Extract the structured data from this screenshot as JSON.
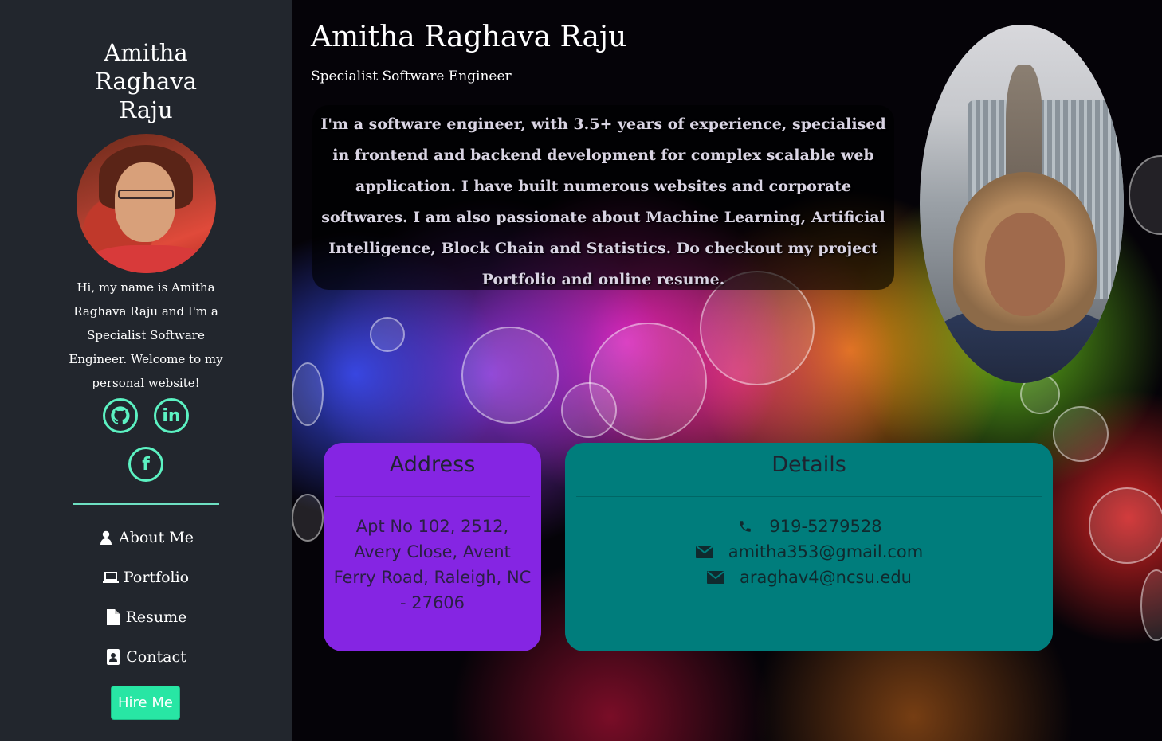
{
  "sidebar": {
    "name_lines": [
      "Amitha",
      "Raghava",
      "Raju"
    ],
    "intro": "Hi, my name is Amitha Raghava Raju and I'm a Specialist Software Engineer. Welcome to my personal website!",
    "social": [
      {
        "icon": "github-icon",
        "glyph": ""
      },
      {
        "icon": "linkedin-icon",
        "glyph": "in"
      },
      {
        "icon": "facebook-icon",
        "glyph": "f"
      }
    ],
    "nav": [
      {
        "label": "About Me",
        "icon": "user-icon"
      },
      {
        "label": "Portfolio",
        "icon": "laptop-icon"
      },
      {
        "label": "Resume",
        "icon": "file-icon"
      },
      {
        "label": "Contact",
        "icon": "contact-card-icon"
      }
    ],
    "hire_label": "Hire Me",
    "accent_color": "#5cf2c2"
  },
  "main": {
    "title": "Amitha Raghava Raju",
    "subtitle": "Specialist Software Engineer",
    "bio": "I'm a software engineer, with 3.5+ years of experience, specialised in frontend and backend development for complex scalable web application. I have built numerous websites and corporate softwares. I am also passionate about Machine Learning, Artificial Intelligence, Block Chain and Statistics. Do checkout my project Portfolio and online resume.",
    "address": {
      "title": "Address",
      "text": "Apt No 102, 2512, Avery Close, Avent Ferry Road, Raleigh, NC - 27606",
      "color": "#8525e3"
    },
    "details": {
      "title": "Details",
      "items": [
        {
          "icon": "phone-icon",
          "text": "919-5279528"
        },
        {
          "icon": "envelope-icon",
          "text": "amitha353@gmail.com"
        },
        {
          "icon": "envelope-icon",
          "text": "araghav4@ncsu.edu"
        }
      ],
      "color": "#007d7c"
    }
  }
}
